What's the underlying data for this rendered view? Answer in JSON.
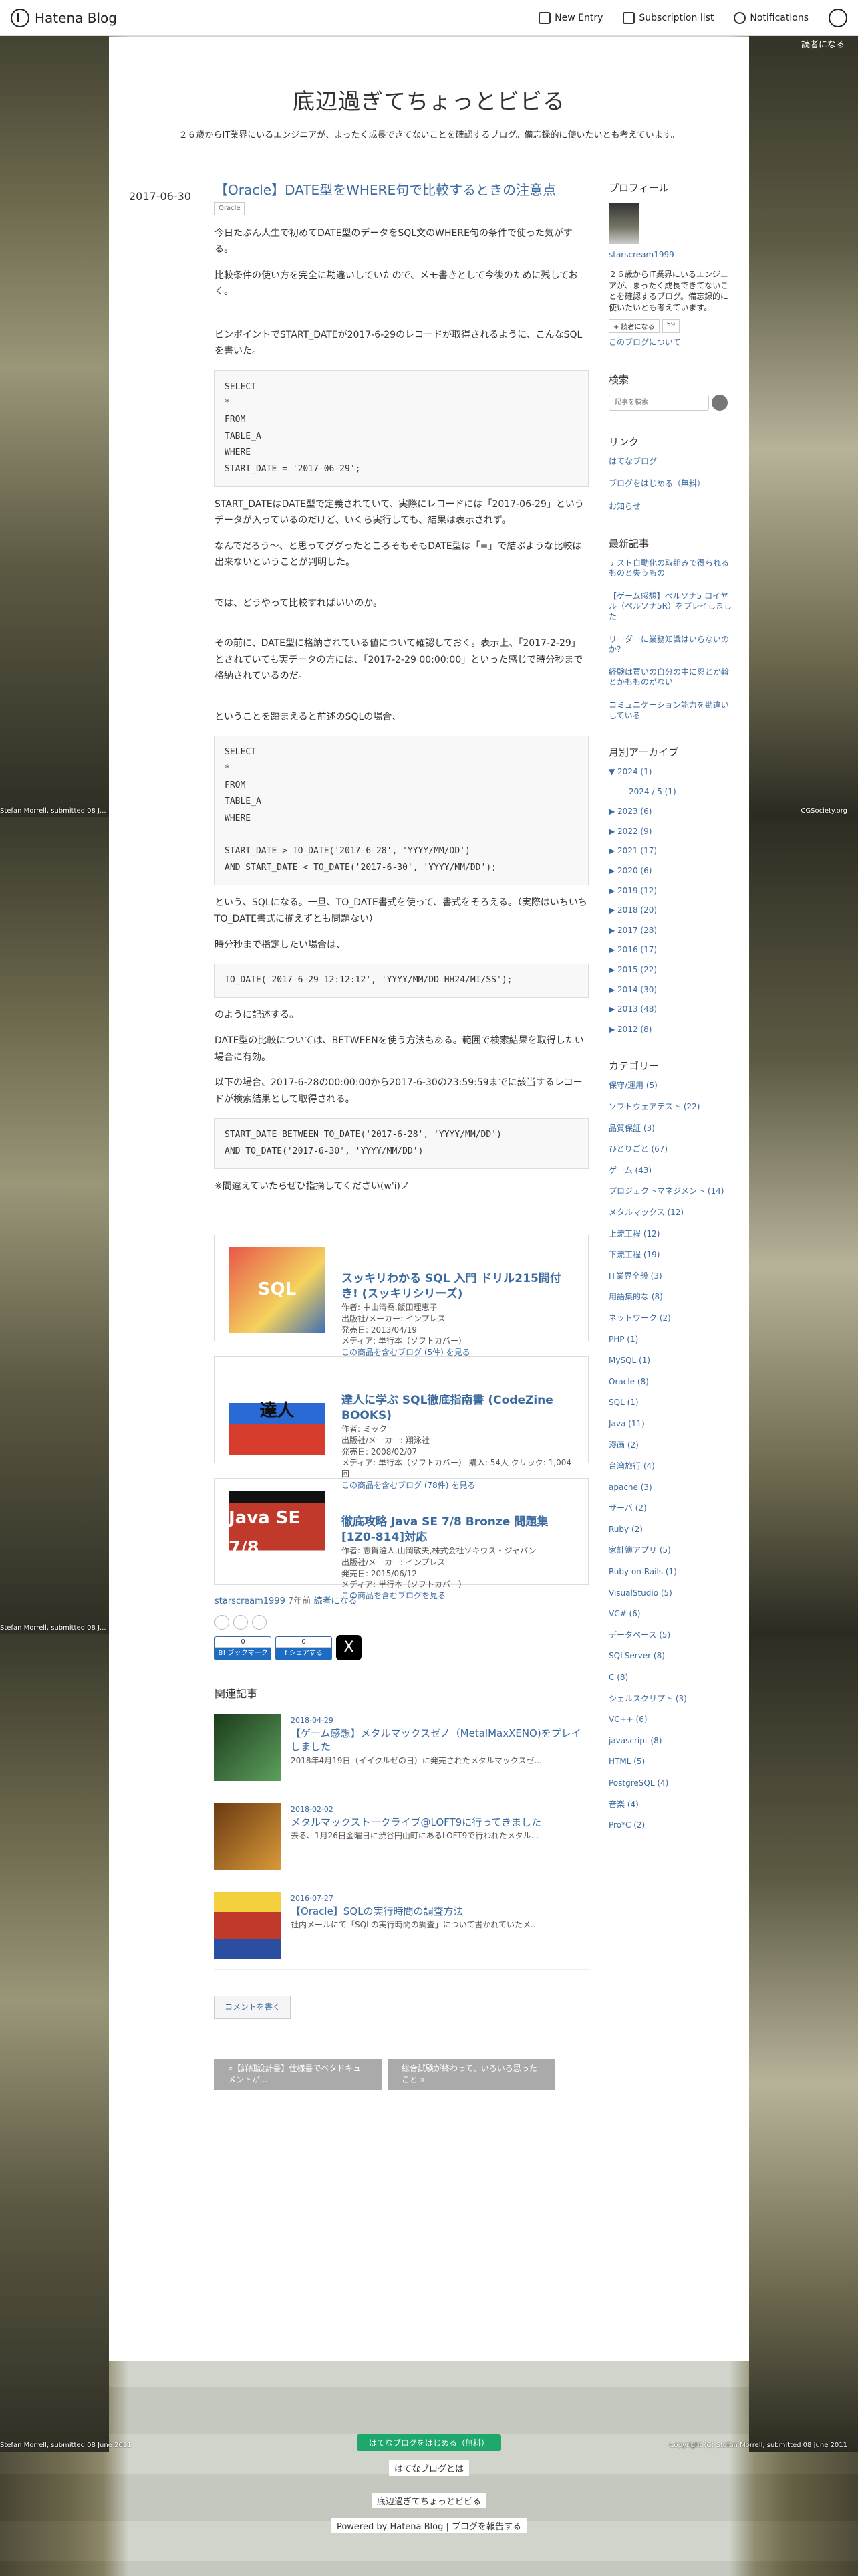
{
  "topbar": {
    "logo": "Hatena Blog",
    "new_entry": "New Entry",
    "subscription": "Subscription list",
    "notifications": "Notifications",
    "reader": "読者になる"
  },
  "blog": {
    "title": "底辺過ぎてちょっとビビる",
    "description": "２６歳からIT業界にいるエンジニアが、まったく成長できてないことを確認するブログ。備忘録的に使いたいとも考えています。"
  },
  "entry": {
    "date": "2017-06-30",
    "title": "【Oracle】DATE型をWHERE句で比較するときの注意点",
    "category": "Oracle",
    "p1": "今日たぶん人生で初めてDATE型のデータをSQL文のWHERE句の条件で使った気がする。",
    "p2": "比較条件の使い方を完全に勘違いしていたので、メモ書きとして今後のために残しておく。",
    "p3": "ピンポイントでSTART_DATEが2017-6-29のレコードが取得されるように、こんなSQLを書いた。",
    "code1": "SELECT\n*\nFROM\nTABLE_A\nWHERE\nSTART_DATE = '2017-06-29';",
    "p4": "START_DATEはDATE型で定義されていて、実際にレコードには「2017-06-29」というデータが入っているのだけど、いくら実行しても、結果は表示されず。",
    "p5": "なんでだろう〜、と思ってググったところそもそもDATE型は「=」で結ぶような比較は出来ないということが判明した。",
    "p6": "では、どうやって比較すればいいのか。",
    "p7": "その前に、DATE型に格納されている値について確認しておく。表示上、「2017-2-29」とされていても実データの方には、「2017-2-29 00:00:00」といった感じで時分秒まで格納されているのだ。",
    "p8": "ということを踏まえると前述のSQLの場合、",
    "code2": "SELECT\n*\nFROM\nTABLE_A\nWHERE\n\nSTART_DATE > TO_DATE('2017-6-28', 'YYYY/MM/DD')\nAND START_DATE < TO_DATE('2017-6-30', 'YYYY/MM/DD');",
    "p9": "という、SQLになる。一旦、TO_DATE書式を使って、書式をそろえる。（実際はいちいちTO_DATE書式に揃えずとも問題ない）",
    "p10": "時分秒まで指定したい場合は、",
    "code3": "TO_DATE('2017-6-29 12:12:12', 'YYYY/MM/DD HH24/MI/SS');",
    "p11": "のように記述する。",
    "p12": "DATE型の比較については、BETWEENを使う方法もある。範囲で検索結果を取得したい場合に有効。",
    "p13": "以下の場合、2017-6-28の00:00:00から2017-6-30の23:59:59までに該当するレコードが検索結果として取得される。",
    "code4": "START_DATE BETWEEN TO_DATE('2017-6-28', 'YYYY/MM/DD')\nAND TO_DATE('2017-6-30', 'YYYY/MM/DD')",
    "p14": "※間違えていたらぜひ指摘してください(w'i)ノ"
  },
  "affiliates": [
    {
      "img": "SQL",
      "title": "スッキリわかる SQL 入門 ドリル215問付き! (スッキリシリーズ)",
      "m1": "作者: 中山清喬,飯田理恵子",
      "m2": "出版社/メーカー: インプレス",
      "m3": "発売日: 2013/04/19",
      "m4": "メディア: 単行本（ソフトカバー）",
      "link": "この商品を含むブログ (5件) を見る"
    },
    {
      "img": "達人",
      "title": "達人に学ぶ SQL徹底指南書 (CodeZine BOOKS)",
      "m1": "作者: ミック",
      "m2": "出版社/メーカー: 翔泳社",
      "m3": "発売日: 2008/02/07",
      "m4": "メディア: 単行本（ソフトカバー） 購入: 54人 クリック: 1,004回",
      "link": "この商品を含むブログ (78件) を見る"
    },
    {
      "img": "Java SE 7/8",
      "title": "徹底攻略 Java SE 7/8 Bronze 問題集[1Z0-814]対応",
      "m1": "作者: 志賀澄人,山岡敏夫,株式会社ソキウス・ジャパン",
      "m2": "出版社/メーカー: インプレス",
      "m3": "発売日: 2015/06/12",
      "m4": "メディア: 単行本（ソフトカバー）",
      "link": "この商品を含むブログを見る"
    }
  ],
  "footer_meta": {
    "author": "starscream1999",
    "ago": "7年前",
    "reader": "読者になる",
    "hatebu_count": "0",
    "hatebu_label": "B! ブックマーク",
    "fb_count": "0",
    "fb_label": "f シェアする",
    "x_label": "X"
  },
  "related": {
    "heading": "関連記事",
    "items": [
      {
        "date": "2018-04-29",
        "title": "【ゲーム感想】メタルマックスゼノ（MetalMaxXENO)をプレイしました",
        "excerpt": "2018年4月19日（イイクルゼの日）に発売されたメタルマックスゼ..."
      },
      {
        "date": "2018-02-02",
        "title": "メタルマックストークライブ@LOFT9に行ってきました",
        "excerpt": "去る、1月26日金曜日に渋谷円山町にあるLOFT9で行われたメタル..."
      },
      {
        "date": "2016-07-27",
        "title": "【Oracle】SQLの実行時間の調査方法",
        "excerpt": "社内メールにて「SQLの実行時間の調査」について書かれていたメ..."
      }
    ]
  },
  "comment_button": "コメントを書く",
  "pager": {
    "prev": "«【詳細設計書】仕様書でベタドキュメントが...",
    "next": "総合試験が終わって、いろいろ思ったこと »"
  },
  "sidebar": {
    "profile_h": "プロフィール",
    "profile_name": "starscream1999",
    "profile_text": "２６歳からIT業界にいるエンジニアが、まったく成長できてないことを確認するブログ。備忘録的に使いたいとも考えています。",
    "follow_label": "+ 読者になる",
    "follow_count": "59",
    "about": "このブログについて",
    "search_h": "検索",
    "search_placeholder": "記事を検索",
    "links_h": "リンク",
    "links": [
      "はてなブログ",
      "ブログをはじめる（無料）",
      "お知らせ"
    ],
    "recent_h": "最新記事",
    "recent": [
      "テスト自動化の取組みで得られるものと失うもの",
      "【ゲーム感想】ペルソナ5 ロイヤル（ペルソナ5R）をプレイしました",
      "リーダーに業務知識はいらないのか？",
      "経験は買いの自分の中に忍とか斡とかもものがない",
      "コミュニケーション能力を勘違いしている"
    ],
    "archive_h": "月別アーカイブ",
    "archive": [
      "▼ 2024 (1)",
      "2024 / 5 (1)",
      "▶ 2023 (6)",
      "▶ 2022 (9)",
      "▶ 2021 (17)",
      "▶ 2020 (6)",
      "▶ 2019 (12)",
      "▶ 2018 (20)",
      "▶ 2017 (28)",
      "▶ 2016 (17)",
      "▶ 2015 (22)",
      "▶ 2014 (30)",
      "▶ 2013 (48)",
      "▶ 2012 (8)"
    ],
    "category_h": "カテゴリー",
    "categories": [
      "保守/運用 (5)",
      "ソフトウェアテスト (22)",
      "品質保証 (3)",
      "ひとりごと (67)",
      "ゲーム (43)",
      "プロジェクトマネジメント (14)",
      "メタルマックス (12)",
      "上流工程 (12)",
      "下流工程 (19)",
      "IT業界全般 (3)",
      "用語集的な (8)",
      "ネットワーク (2)",
      "PHP (1)",
      "MySQL (1)",
      "Oracle (8)",
      "SQL (1)",
      "Java (11)",
      "漫画 (2)",
      "台湾旅行 (4)",
      "apache (3)",
      "サーバ (2)",
      "Ruby (2)",
      "家計簿アプリ (5)",
      "Ruby on Rails (1)",
      "VisualStudio (5)",
      "VC# (6)",
      "データベース (5)",
      "SQLServer (8)",
      "C (8)",
      "シェルスクリプト (3)",
      "VC++ (6)",
      "javascript (8)",
      "HTML (5)",
      "PostgreSQL (4)",
      "音楽 (4)",
      "Pro*C (2)"
    ]
  },
  "credits": {
    "left": "Stefan Morrell, submitted 08 J...",
    "right": "CGSociety.org",
    "bottom_left": "Stefan Morrell, submitted 08 June 2011",
    "bottom_right": "Copyright (C) Stefan Morrell, submitted 08 June 2011"
  },
  "footer": {
    "start": "はてなブログをはじめる（無料）",
    "what": "はてなブログとは",
    "blog": "底辺過ぎてちょっとビビる",
    "powered": "Powered by Hatena Blog | ブログを報告する"
  }
}
